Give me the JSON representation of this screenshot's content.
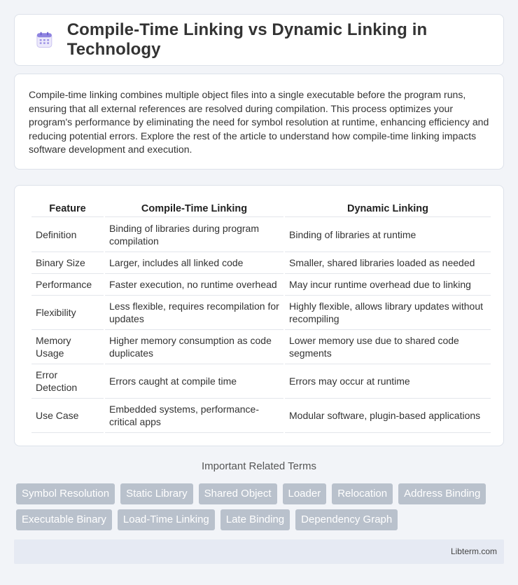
{
  "header": {
    "title": "Compile-Time Linking vs Dynamic Linking in Technology",
    "icon": "calendar-grid-icon"
  },
  "intro": {
    "text": "Compile-time linking combines multiple object files into a single executable before the program runs, ensuring that all external references are resolved during compilation. This process optimizes your program's performance by eliminating the need for symbol resolution at runtime, enhancing efficiency and reducing potential errors. Explore the rest of the article to understand how compile-time linking impacts software development and execution."
  },
  "table": {
    "headers": [
      "Feature",
      "Compile-Time Linking",
      "Dynamic Linking"
    ],
    "rows": [
      [
        "Definition",
        "Binding of libraries during program compilation",
        "Binding of libraries at runtime"
      ],
      [
        "Binary Size",
        "Larger, includes all linked code",
        "Smaller, shared libraries loaded as needed"
      ],
      [
        "Performance",
        "Faster execution, no runtime overhead",
        "May incur runtime overhead due to linking"
      ],
      [
        "Flexibility",
        "Less flexible, requires recompilation for updates",
        "Highly flexible, allows library updates without recompiling"
      ],
      [
        "Memory Usage",
        "Higher memory consumption as code duplicates",
        "Lower memory use due to shared code segments"
      ],
      [
        "Error Detection",
        "Errors caught at compile time",
        "Errors may occur at runtime"
      ],
      [
        "Use Case",
        "Embedded systems, performance-critical apps",
        "Modular software, plugin-based applications"
      ]
    ]
  },
  "related": {
    "title": "Important Related Terms",
    "tags_row1": [
      "Symbol Resolution",
      "Static Library",
      "Shared Object",
      "Loader",
      "Relocation",
      "Address Binding"
    ],
    "tags_row2": [
      "Executable Binary",
      "Load-Time Linking",
      "Late Binding",
      "Dependency Graph"
    ]
  },
  "footer": {
    "brand": "Libterm.com"
  },
  "colors": {
    "tag_bg": "#b9c1cc",
    "footer_bg": "#e6eaf3",
    "icon_accent": "#7b6fd6"
  }
}
